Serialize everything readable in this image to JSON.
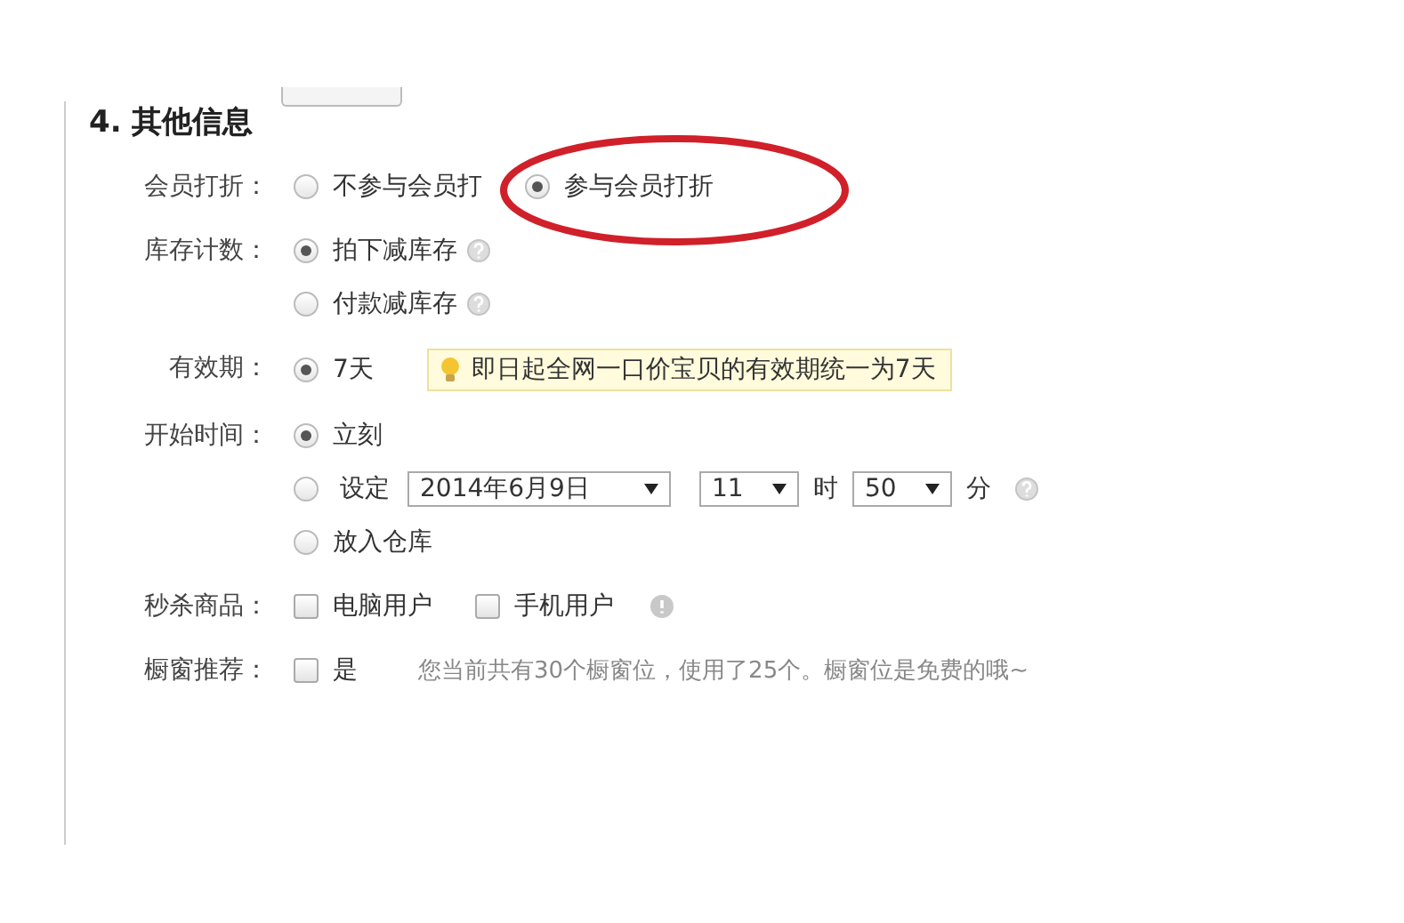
{
  "section": {
    "title": "4. 其他信息",
    "rows": [
      {
        "label": "会员打折：",
        "kind": "radio",
        "options": [
          {
            "label": "不参与会员打",
            "selected": false
          },
          {
            "label": "参与会员打折",
            "selected": true,
            "circled": true
          }
        ]
      },
      {
        "label": "库存计数：",
        "kind": "radio_list",
        "options": [
          {
            "label": "拍下减库存",
            "selected": true,
            "help": true
          },
          {
            "label": "付款减库存",
            "selected": false,
            "help": true
          }
        ]
      },
      {
        "label": "有效期：",
        "kind": "radio",
        "options": [
          {
            "label": "7天",
            "selected": true
          }
        ],
        "tip": "即日起全网一口价宝贝的有效期统一为7天"
      },
      {
        "label": "开始时间：",
        "kind": "radio_list",
        "options": [
          {
            "label": "立刻",
            "selected": true
          },
          {
            "label": "设定",
            "selected": false,
            "kind": "datetime",
            "date": "2014年6月9日",
            "hour": "11",
            "hour_unit": "时",
            "minute": "50",
            "minute_unit": "分",
            "help": true
          },
          {
            "label": "放入仓库",
            "selected": false
          }
        ]
      },
      {
        "label": "秒杀商品：",
        "kind": "checkbox",
        "options": [
          {
            "label": "电脑用户",
            "checked": false
          },
          {
            "label": "手机用户",
            "checked": false
          }
        ],
        "info": true
      },
      {
        "label": "橱窗推荐：",
        "kind": "checkbox",
        "options": [
          {
            "label": "是",
            "checked": false
          }
        ],
        "note": "您当前共有30个橱窗位，使用了25个。橱窗位是免费的哦~"
      }
    ]
  }
}
